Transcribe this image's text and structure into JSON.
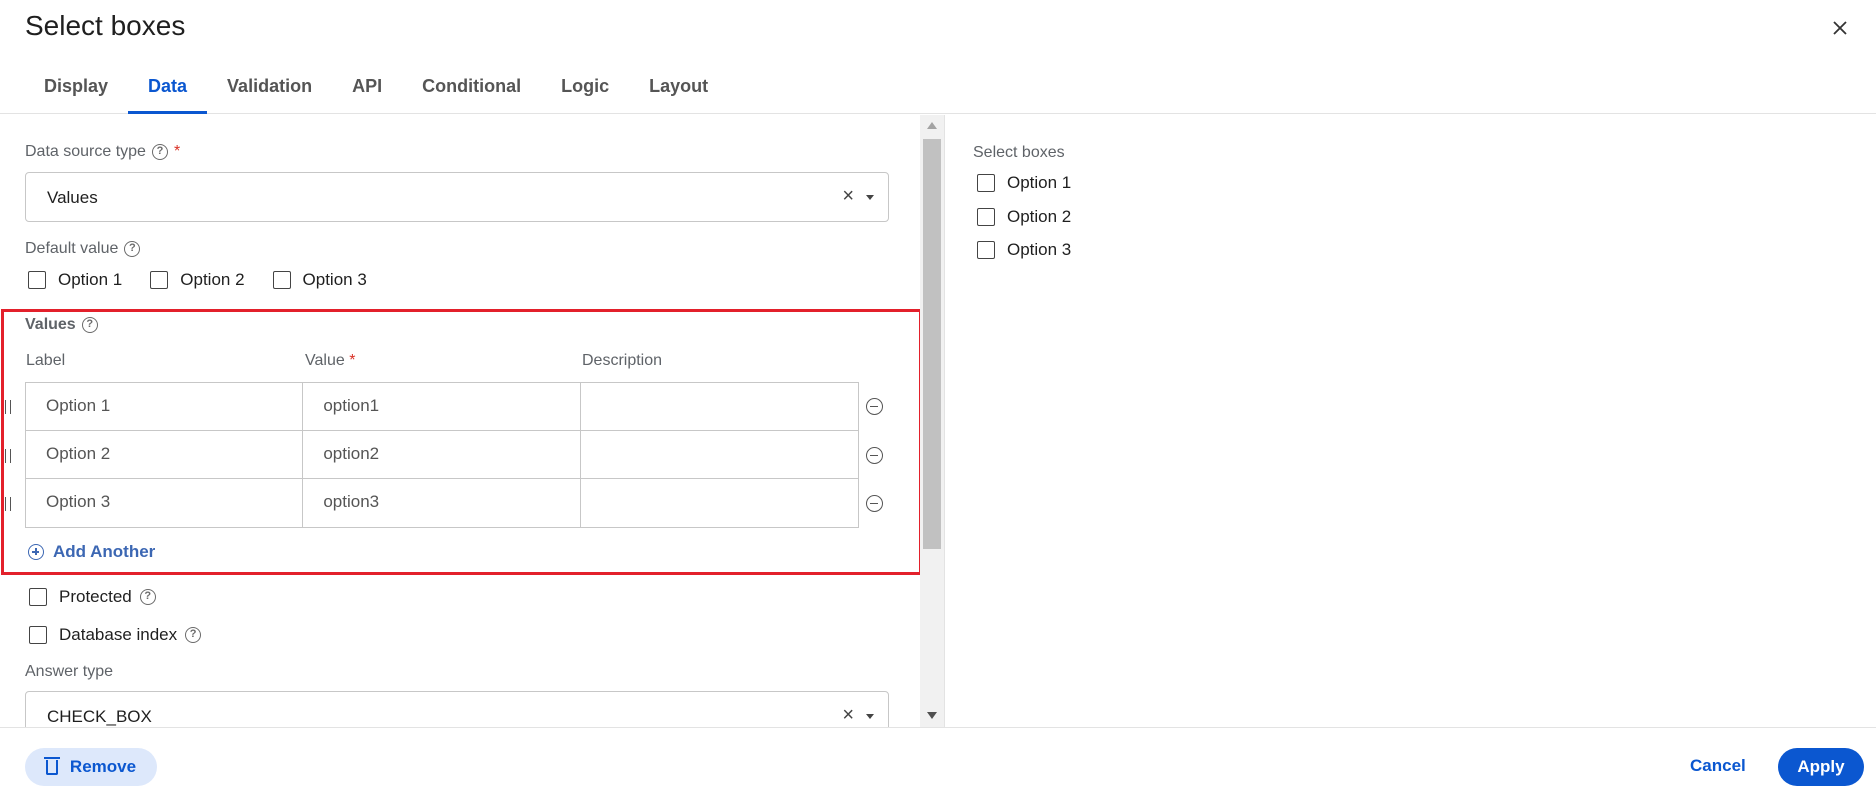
{
  "dialog": {
    "title": "Select boxes"
  },
  "tabs": [
    {
      "label": "Display"
    },
    {
      "label": "Data",
      "active": true
    },
    {
      "label": "Validation"
    },
    {
      "label": "API"
    },
    {
      "label": "Conditional"
    },
    {
      "label": "Logic"
    },
    {
      "label": "Layout"
    }
  ],
  "data_source": {
    "label": "Data source type",
    "required_mark": "*",
    "value": "Values",
    "clear_glyph": "×"
  },
  "default_value": {
    "label": "Default value",
    "options": [
      {
        "label": "Option 1"
      },
      {
        "label": "Option 2"
      },
      {
        "label": "Option 3"
      }
    ]
  },
  "values": {
    "title": "Values",
    "columns": {
      "label": "Label",
      "value": "Value",
      "value_required": "*",
      "description": "Description"
    },
    "rows": [
      {
        "label": "Option 1",
        "value": "option1",
        "description": ""
      },
      {
        "label": "Option 2",
        "value": "option2",
        "description": ""
      },
      {
        "label": "Option 3",
        "value": "option3",
        "description": ""
      }
    ],
    "add_label": "Add Another"
  },
  "protected": {
    "label": "Protected"
  },
  "database_index": {
    "label": "Database index"
  },
  "answer_type": {
    "label": "Answer type",
    "value": "CHECK_BOX",
    "clear_glyph": "×"
  },
  "preview": {
    "title": "Select boxes",
    "options": [
      {
        "label": "Option 1"
      },
      {
        "label": "Option 2"
      },
      {
        "label": "Option 3"
      }
    ]
  },
  "footer": {
    "remove_label": "Remove",
    "cancel_label": "Cancel",
    "apply_label": "Apply"
  },
  "icons": {
    "close": "close-icon",
    "help": "help-icon",
    "remove_row": "minus-circle-icon",
    "add": "plus-circle-icon",
    "trash": "trash-icon",
    "drag": "drag-handle-icon"
  },
  "colors": {
    "accent": "#0b57d0",
    "highlight_border": "#e3202b",
    "required": "#d93025"
  }
}
